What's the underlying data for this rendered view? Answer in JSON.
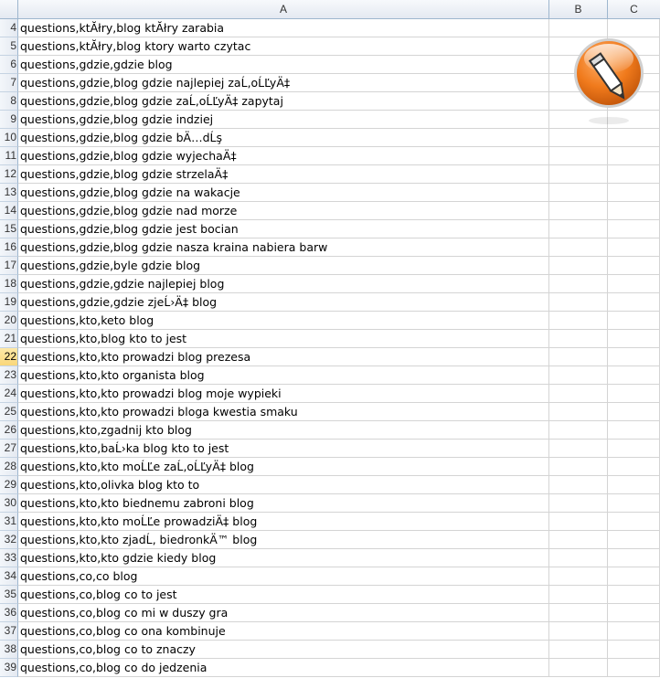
{
  "columns": [
    "A",
    "B",
    "C"
  ],
  "active_row": 22,
  "accent": {
    "header_bg": "#e4e9f1",
    "active_row_header": "#f9d77a",
    "icon_orange": "#f07a1c"
  },
  "icon": {
    "name": "pencil-app-icon"
  },
  "rows": [
    {
      "num": "4",
      "a": "questions,ktĂłry,blog ktĂłry zarabia"
    },
    {
      "num": "5",
      "a": "questions,ktĂłry,blog ktory warto czytac"
    },
    {
      "num": "6",
      "a": "questions,gdzie,gdzie blog"
    },
    {
      "num": "7",
      "a": "questions,gdzie,blog gdzie najlepiej zaĹ‚oĹĽyÄ‡"
    },
    {
      "num": "8",
      "a": "questions,gdzie,blog gdzie zaĹ‚oĹĽyÄ‡ zapytaj"
    },
    {
      "num": "9",
      "a": "questions,gdzie,blog gdzie indziej"
    },
    {
      "num": "10",
      "a": "questions,gdzie,blog gdzie bÄ…dĹş"
    },
    {
      "num": "11",
      "a": "questions,gdzie,blog gdzie wyjechaÄ‡"
    },
    {
      "num": "12",
      "a": "questions,gdzie,blog gdzie strzelaÄ‡"
    },
    {
      "num": "13",
      "a": "questions,gdzie,blog gdzie na wakacje"
    },
    {
      "num": "14",
      "a": "questions,gdzie,blog gdzie nad morze"
    },
    {
      "num": "15",
      "a": "questions,gdzie,blog gdzie jest bocian"
    },
    {
      "num": "16",
      "a": "questions,gdzie,blog gdzie nasza kraina nabiera barw"
    },
    {
      "num": "17",
      "a": "questions,gdzie,byle gdzie blog"
    },
    {
      "num": "18",
      "a": "questions,gdzie,gdzie najlepiej blog"
    },
    {
      "num": "19",
      "a": "questions,gdzie,gdzie zjeĹ›Ä‡ blog"
    },
    {
      "num": "20",
      "a": "questions,kto,keto blog"
    },
    {
      "num": "21",
      "a": "questions,kto,blog kto to jest"
    },
    {
      "num": "22",
      "a": "questions,kto,kto prowadzi blog prezesa"
    },
    {
      "num": "23",
      "a": "questions,kto,kto organista blog"
    },
    {
      "num": "24",
      "a": "questions,kto,kto prowadzi blog moje wypieki"
    },
    {
      "num": "25",
      "a": "questions,kto,kto prowadzi bloga kwestia smaku"
    },
    {
      "num": "26",
      "a": "questions,kto,zgadnij kto blog"
    },
    {
      "num": "27",
      "a": "questions,kto,baĹ›ka blog kto to jest"
    },
    {
      "num": "28",
      "a": "questions,kto,kto moĹĽe zaĹ‚oĹĽyÄ‡ blog"
    },
    {
      "num": "29",
      "a": "questions,kto,olivka blog kto to"
    },
    {
      "num": "30",
      "a": "questions,kto,kto biednemu zabroni blog"
    },
    {
      "num": "31",
      "a": "questions,kto,kto moĹĽe prowadziÄ‡ blog"
    },
    {
      "num": "32",
      "a": "questions,kto,kto zjadĹ‚ biedronkÄ™ blog"
    },
    {
      "num": "33",
      "a": "questions,kto,kto gdzie kiedy blog"
    },
    {
      "num": "34",
      "a": "questions,co,co blog"
    },
    {
      "num": "35",
      "a": "questions,co,blog co to jest"
    },
    {
      "num": "36",
      "a": "questions,co,blog co mi w duszy gra"
    },
    {
      "num": "37",
      "a": "questions,co,blog co ona kombinuje"
    },
    {
      "num": "38",
      "a": "questions,co,blog co to znaczy"
    },
    {
      "num": "39",
      "a": "questions,co,blog co do jedzenia"
    }
  ]
}
